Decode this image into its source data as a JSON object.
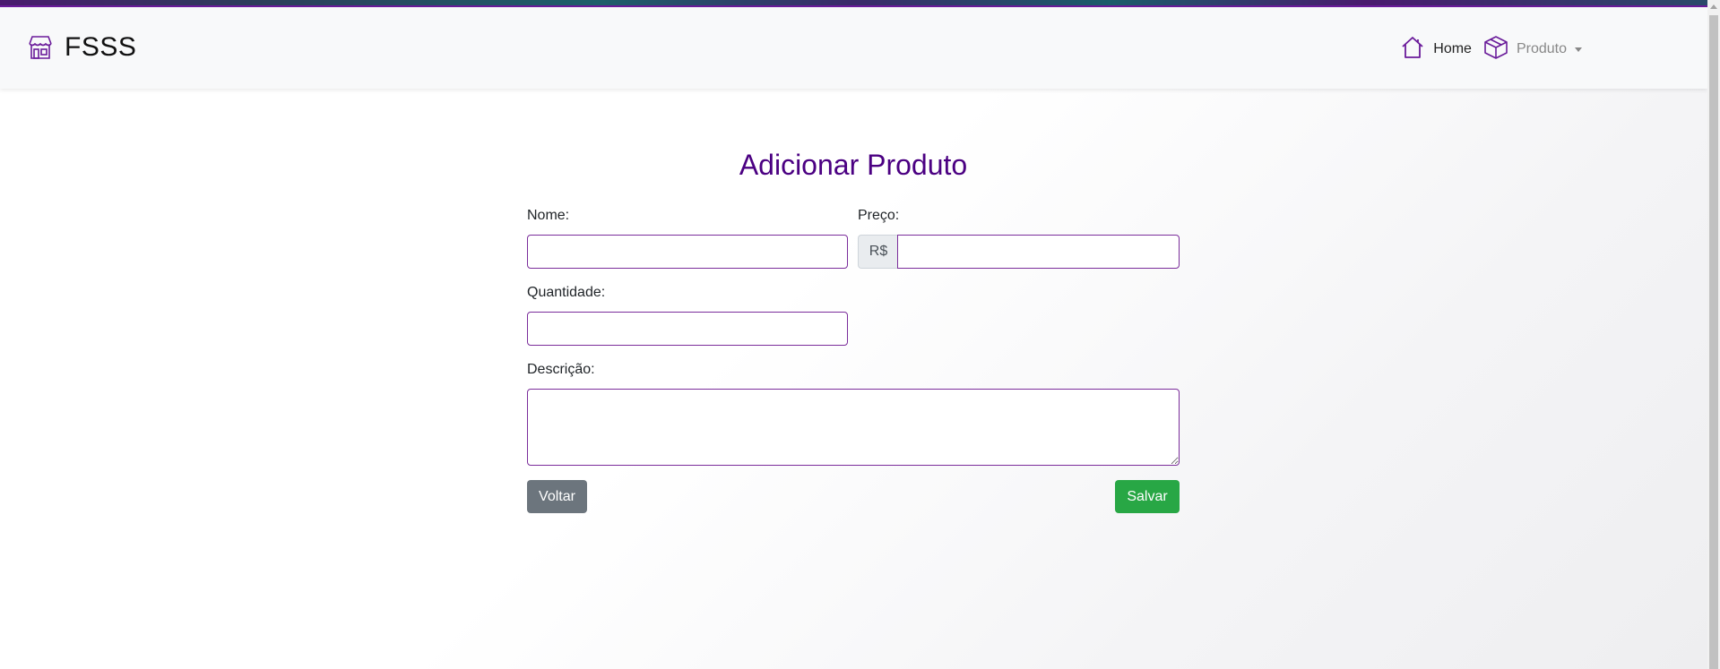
{
  "navbar": {
    "brand": "FSSS",
    "brand_icon": "store-icon",
    "items": [
      {
        "label": "Home",
        "icon": "home-icon"
      },
      {
        "label": "Produto",
        "icon": "box-icon",
        "dropdown": true
      }
    ]
  },
  "form": {
    "title": "Adicionar Produto",
    "fields": {
      "nome": {
        "label": "Nome:",
        "value": ""
      },
      "preco": {
        "label": "Preço:",
        "prefix": "R$",
        "value": ""
      },
      "quantidade": {
        "label": "Quantidade:",
        "value": ""
      },
      "descricao": {
        "label": "Descrição:",
        "value": ""
      }
    },
    "buttons": {
      "back": "Voltar",
      "save": "Salvar"
    }
  },
  "colors": {
    "accent": "#4b0082",
    "input_border": "#7b2d9b",
    "save_button": "#28a745",
    "back_button": "#6c757d"
  }
}
